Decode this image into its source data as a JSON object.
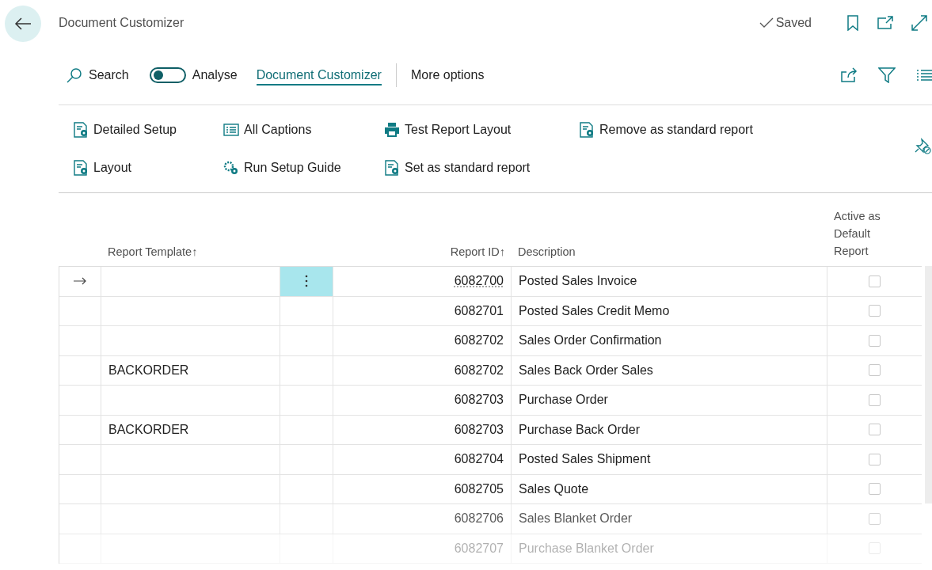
{
  "page": {
    "title": "Document Customizer",
    "status": "Saved"
  },
  "action_bar": {
    "search": "Search",
    "analyse": {
      "label": "Analyse",
      "on": false
    },
    "tabs": [
      {
        "label": "Document Customizer",
        "selected": true
      }
    ],
    "more": "More options"
  },
  "actions": [
    {
      "label": "Detailed Setup",
      "kind": "document"
    },
    {
      "label": "All Captions",
      "kind": "list"
    },
    {
      "label": "Test Report Layout",
      "kind": "printer"
    },
    {
      "label": "Remove as standard report",
      "kind": "document"
    },
    {
      "label": "Layout",
      "kind": "document"
    },
    {
      "label": "Run Setup Guide",
      "kind": "gears"
    },
    {
      "label": "Set as standard report",
      "kind": "document"
    }
  ],
  "table": {
    "columns": [
      {
        "label": "Report Template",
        "sort": "↑"
      },
      {
        "label": "Report ID",
        "sort": "↑"
      },
      {
        "label": "Description"
      },
      {
        "label": "Active as Default Report"
      }
    ],
    "rows": [
      {
        "template": "",
        "report_id": "6082700",
        "description": "Posted Sales Invoice",
        "active": false,
        "selected": true
      },
      {
        "template": "",
        "report_id": "6082701",
        "description": "Posted Sales Credit Memo",
        "active": false,
        "selected": false
      },
      {
        "template": "",
        "report_id": "6082702",
        "description": "Sales Order Confirmation",
        "active": false,
        "selected": false
      },
      {
        "template": "BACKORDER",
        "report_id": "6082702",
        "description": "Sales Back Order Sales",
        "active": false,
        "selected": false
      },
      {
        "template": "",
        "report_id": "6082703",
        "description": "Purchase Order",
        "active": false,
        "selected": false
      },
      {
        "template": "BACKORDER",
        "report_id": "6082703",
        "description": "Purchase Back Order",
        "active": false,
        "selected": false
      },
      {
        "template": "",
        "report_id": "6082704",
        "description": "Posted Sales Shipment",
        "active": false,
        "selected": false
      },
      {
        "template": "",
        "report_id": "6082705",
        "description": "Sales Quote",
        "active": false,
        "selected": false
      },
      {
        "template": "",
        "report_id": "6082706",
        "description": "Sales Blanket Order",
        "active": false,
        "selected": false
      },
      {
        "template": "",
        "report_id": "6082707",
        "description": "Purchase Blanket Order",
        "active": false,
        "selected": false
      }
    ]
  }
}
